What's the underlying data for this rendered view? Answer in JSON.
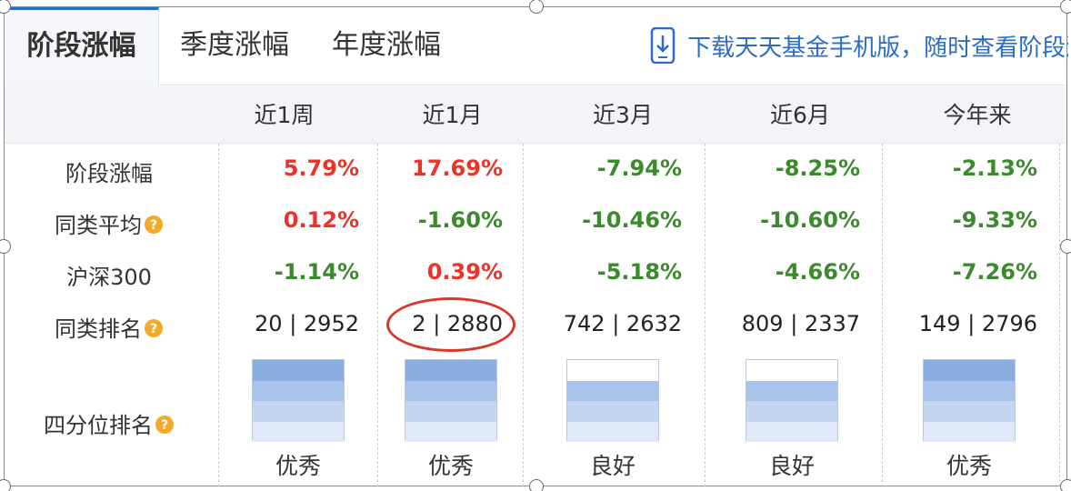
{
  "tabs": {
    "active": "阶段涨幅",
    "quarterly": "季度涨幅",
    "yearly": "年度涨幅",
    "promo": "下载天天基金手机版，随时查看阶段涨"
  },
  "columns": [
    "近1周",
    "近1月",
    "近3月",
    "近6月",
    "今年来"
  ],
  "rows": {
    "stage_return": {
      "label": "阶段涨幅",
      "values": [
        {
          "text": "5.79%",
          "sign": "pos"
        },
        {
          "text": "17.69%",
          "sign": "pos"
        },
        {
          "text": "-7.94%",
          "sign": "neg"
        },
        {
          "text": "-8.25%",
          "sign": "neg"
        },
        {
          "text": "-2.13%",
          "sign": "neg"
        }
      ]
    },
    "category_avg": {
      "label": "同类平均",
      "values": [
        {
          "text": "0.12%",
          "sign": "pos"
        },
        {
          "text": "-1.60%",
          "sign": "neg"
        },
        {
          "text": "-10.46%",
          "sign": "neg"
        },
        {
          "text": "-10.60%",
          "sign": "neg"
        },
        {
          "text": "-9.33%",
          "sign": "neg"
        }
      ]
    },
    "hs300": {
      "label": "沪深300",
      "values": [
        {
          "text": "-1.14%",
          "sign": "neg"
        },
        {
          "text": "0.39%",
          "sign": "pos"
        },
        {
          "text": "-5.18%",
          "sign": "neg"
        },
        {
          "text": "-4.66%",
          "sign": "neg"
        },
        {
          "text": "-7.26%",
          "sign": "neg"
        }
      ]
    },
    "category_rank": {
      "label": "同类排名",
      "values": [
        "20 | 2952",
        "2 | 2880",
        "742 | 2632",
        "809 | 2337",
        "149 | 2796"
      ]
    },
    "quartile": {
      "label": "四分位排名",
      "items": [
        {
          "label": "优秀",
          "level": 4
        },
        {
          "label": "优秀",
          "level": 4
        },
        {
          "label": "良好",
          "level": 3
        },
        {
          "label": "良好",
          "level": 3
        },
        {
          "label": "优秀",
          "level": 4
        }
      ]
    }
  },
  "colors": {
    "positive": "#e8342a",
    "negative": "#3c8a2e",
    "link": "#2b6cc4",
    "highlight": "#d9372c"
  },
  "icons": [
    "phone-icon",
    "question-icon"
  ]
}
